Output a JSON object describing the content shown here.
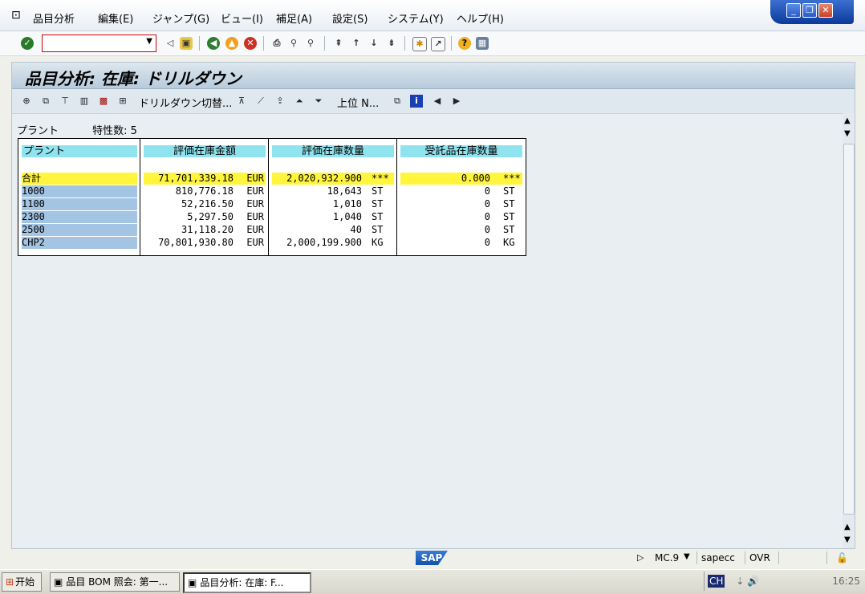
{
  "menu": {
    "items": [
      "品目分析",
      "編集(E)",
      "ジャンプ(G)",
      "ビュー(I)",
      "補足(A)",
      "設定(S)",
      "システム(Y)",
      "ヘルプ(H)"
    ]
  },
  "toolbar": {
    "command_value": ""
  },
  "page": {
    "title": "品目分析: 在庫: ドリルダウン"
  },
  "app_toolbar": {
    "drilldown_switch": "ドリルダウン切替...",
    "top_n": "上位 N..."
  },
  "info": {
    "plant_label": "プラント",
    "characteristics": "特性数: 5"
  },
  "table": {
    "headers": [
      "プラント",
      "評価在庫金額",
      "評価在庫数量",
      "受託品在庫数量"
    ],
    "total": {
      "key": "合計",
      "amount": "71,701,339.18",
      "amount_unit": "EUR",
      "qty": "2,020,932.900",
      "qty_unit": "***",
      "consign": "0.000",
      "consign_unit": "***"
    },
    "rows": [
      {
        "key": "1000",
        "amount": "810,776.18",
        "amount_unit": "EUR",
        "qty": "18,643",
        "qty_unit": "ST",
        "consign": "0",
        "consign_unit": "ST"
      },
      {
        "key": "1100",
        "amount": "52,216.50",
        "amount_unit": "EUR",
        "qty": "1,010",
        "qty_unit": "ST",
        "consign": "0",
        "consign_unit": "ST"
      },
      {
        "key": "2300",
        "amount": "5,297.50",
        "amount_unit": "EUR",
        "qty": "1,040",
        "qty_unit": "ST",
        "consign": "0",
        "consign_unit": "ST"
      },
      {
        "key": "2500",
        "amount": "31,118.20",
        "amount_unit": "EUR",
        "qty": "40",
        "qty_unit": "ST",
        "consign": "0",
        "consign_unit": "ST"
      },
      {
        "key": "CHP2",
        "amount": "70,801,930.80",
        "amount_unit": "EUR",
        "qty": "2,000,199.900",
        "qty_unit": "KG",
        "consign": "0",
        "consign_unit": "KG"
      }
    ]
  },
  "status": {
    "sap": "SAP",
    "transaction": "MC.9",
    "server": "sapecc",
    "mode": "OVR"
  },
  "taskbar": {
    "start": "开始",
    "tasks": [
      "品目 BOM 照会: 第一...",
      "品目分析: 在庫: F..."
    ],
    "tray_text": "CH",
    "clock": "16:25"
  },
  "colors": {
    "header_cell": "#8fe3ef",
    "key_cell": "#a4c4e4",
    "total_row": "#fff53c"
  }
}
